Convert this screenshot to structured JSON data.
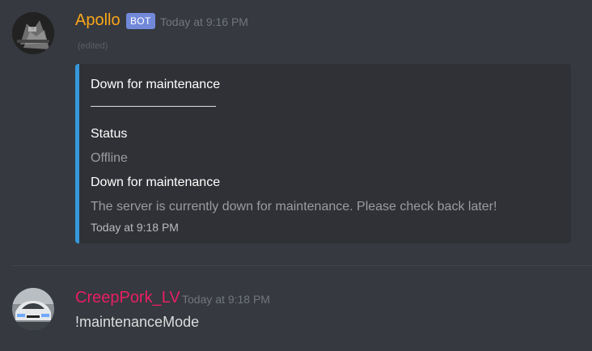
{
  "messages": [
    {
      "username": "Apollo",
      "username_color": "#faa61a",
      "bot_tag": "BOT",
      "timestamp": "Today at 9:16 PM",
      "edited": "(edited)",
      "avatar_icon": "dark-robot-avatar",
      "embed": {
        "accent_color": "#3498db",
        "title": "Down for maintenance",
        "fields": [
          {
            "name": "Status",
            "value": "Offline"
          },
          {
            "name": "Down for maintenance",
            "value": "The server is currently down for maintenance. Please check back later!"
          }
        ],
        "footer": "Today at 9:18 PM"
      }
    },
    {
      "username": "CreepPork_LV",
      "username_color": "#e91e63",
      "timestamp": "Today at 9:18 PM",
      "avatar_icon": "car-avatar",
      "content": "!maintenanceMode"
    }
  ]
}
